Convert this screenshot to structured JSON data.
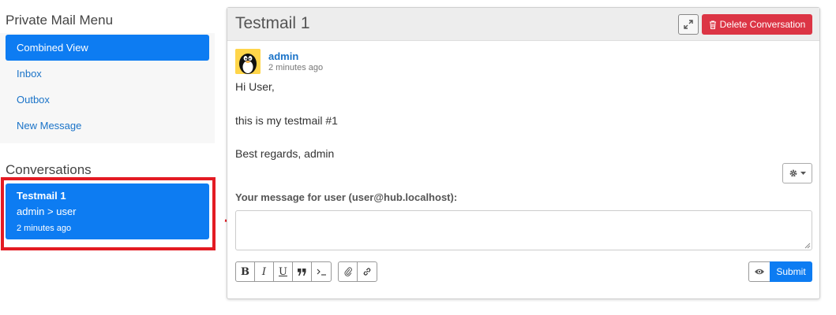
{
  "sidebar": {
    "menu_title": "Private Mail Menu",
    "items": [
      {
        "label": "Combined View",
        "active": true
      },
      {
        "label": "Inbox",
        "active": false
      },
      {
        "label": "Outbox",
        "active": false
      },
      {
        "label": "New Message",
        "active": false
      }
    ],
    "conversations_title": "Conversations",
    "conversations": [
      {
        "title": "Testmail 1",
        "subtitle": "admin > user",
        "time": "2 minutes ago"
      }
    ]
  },
  "conversation": {
    "title": "Testmail 1",
    "expand_icon": "expand-icon",
    "delete_label": "Delete Conversation",
    "message": {
      "author": "admin",
      "time": "2 minutes ago",
      "avatar_icon": "tux-penguin-icon",
      "lines": [
        "Hi User,",
        "this is my testmail #1",
        "Best regards, admin"
      ]
    },
    "settings_icon": "gear-icon",
    "reply_label": "Your message for user (user@hub.localhost):",
    "reply_value": "",
    "toolbar": {
      "bold": "B",
      "italic": "I",
      "underline": "U",
      "quote_icon": "quote-icon",
      "code_icon": "code-icon",
      "attach_icon": "paperclip-icon",
      "link_icon": "link-icon"
    },
    "preview_icon": "eye-icon",
    "submit_label": "Submit"
  },
  "colors": {
    "primary": "#0d7cf2",
    "danger": "#dc3545",
    "highlight_annotation": "#e31b23"
  }
}
